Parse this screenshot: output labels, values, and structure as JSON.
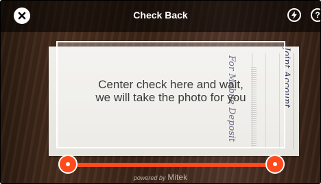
{
  "header": {
    "title": "Check Back",
    "close_icon": "close-icon",
    "flash_icon": "flash-icon",
    "help_label": "?"
  },
  "camera": {
    "instruction_line1": "Center check here and wait,",
    "instruction_line2": "we will take the photo for you"
  },
  "check": {
    "handwriting_line1": "For Mobile Deposit",
    "handwriting_line2": "Joint Account"
  },
  "footer": {
    "powered_by": "powered by",
    "brand": "Mitek"
  },
  "colors": {
    "accent": "#ff4a1c",
    "topbar": "#000000"
  }
}
